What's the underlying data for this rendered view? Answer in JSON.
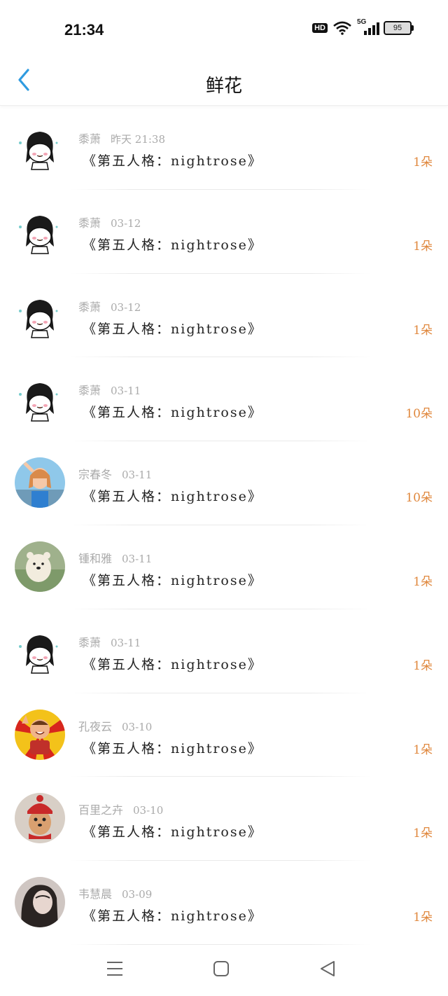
{
  "status_bar": {
    "time": "21:34",
    "hd": "HD",
    "network": "5G",
    "battery": "95"
  },
  "header": {
    "title": "鲜花"
  },
  "items": [
    {
      "name": "黍萧",
      "date": "昨天 21:38",
      "book": "《第五人格：nightrose》",
      "count": "1朵",
      "avatar": "cartoon-girl"
    },
    {
      "name": "黍萧",
      "date": "03-12",
      "book": "《第五人格：nightrose》",
      "count": "1朵",
      "avatar": "cartoon-girl"
    },
    {
      "name": "黍萧",
      "date": "03-12",
      "book": "《第五人格：nightrose》",
      "count": "1朵",
      "avatar": "cartoon-girl"
    },
    {
      "name": "黍萧",
      "date": "03-11",
      "book": "《第五人格：nightrose》",
      "count": "10朵",
      "avatar": "cartoon-girl"
    },
    {
      "name": "宗春冬",
      "date": "03-11",
      "book": "《第五人格：nightrose》",
      "count": "10朵",
      "avatar": "photo-girl"
    },
    {
      "name": "锺和雅",
      "date": "03-11",
      "book": "《第五人格：nightrose》",
      "count": "1朵",
      "avatar": "bear"
    },
    {
      "name": "黍萧",
      "date": "03-11",
      "book": "《第五人格：nightrose》",
      "count": "1朵",
      "avatar": "cartoon-girl"
    },
    {
      "name": "孔夜云",
      "date": "03-10",
      "book": "《第五人格：nightrose》",
      "count": "1朵",
      "avatar": "basketball-kid"
    },
    {
      "name": "百里之卉",
      "date": "03-10",
      "book": "《第五人格：nightrose》",
      "count": "1朵",
      "avatar": "dog-red-hat"
    },
    {
      "name": "韦慧晨",
      "date": "03-09",
      "book": "《第五人格：nightrose》",
      "count": "1朵",
      "avatar": "photo-dark"
    }
  ],
  "colors": {
    "accent": "#2f9be0",
    "count": "#e0883e",
    "meta": "#aaaaaa"
  },
  "nav": {
    "menu_icon": "menu-icon",
    "home_icon": "home-icon",
    "back_icon": "back-triangle-icon"
  }
}
